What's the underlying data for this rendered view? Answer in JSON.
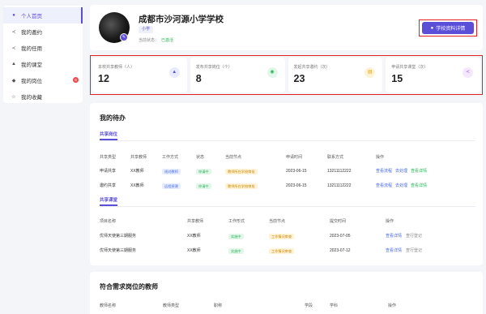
{
  "sidebar": {
    "items": [
      {
        "label": "个人首页",
        "icon": "user-icon",
        "glyph": "●",
        "active": true
      },
      {
        "label": "我的邀约",
        "icon": "share-icon",
        "glyph": "≺"
      },
      {
        "label": "我的任用",
        "icon": "share-icon",
        "glyph": "≺"
      },
      {
        "label": "我的课堂",
        "icon": "graduation-cap-icon",
        "glyph": "▲"
      },
      {
        "label": "我的岗位",
        "icon": "bell-icon",
        "glyph": "◆",
        "badge": "8"
      },
      {
        "label": "我的收藏",
        "icon": "star-icon",
        "glyph": "☆"
      }
    ]
  },
  "profile": {
    "name": "成都市沙河源小学学校",
    "type_tag": "小学",
    "status_label": "当前状态：",
    "status_value": "已激活",
    "detail_button": "学校资料详情"
  },
  "stats": [
    {
      "label": "本校共享教师（人）",
      "value": "12",
      "icon": "graduation-cap-icon",
      "glyph": "▲",
      "icon_bg": "#e8ebff",
      "icon_fg": "#5b4fd8"
    },
    {
      "label": "发布共享岗位（个）",
      "value": "8",
      "icon": "eye-icon",
      "glyph": "◉",
      "icon_bg": "#e3f6ea",
      "icon_fg": "#2bb45a"
    },
    {
      "label": "发起共享邀约（次）",
      "value": "23",
      "icon": "document-icon",
      "glyph": "▤",
      "icon_bg": "#fff3d6",
      "icon_fg": "#e0a020"
    },
    {
      "label": "申请共享课堂（次）",
      "value": "15",
      "icon": "share-icon",
      "glyph": "≺",
      "icon_bg": "#f3e8ff",
      "icon_fg": "#9b59d0"
    }
  ],
  "todo": {
    "title": "我的待办",
    "tab1": "共享岗位",
    "table1": {
      "headers": [
        "共享类型",
        "共享教师",
        "工作方式",
        "状态",
        "当前节点",
        "申请时间",
        "联系方式",
        "操作"
      ],
      "rows": [
        {
          "type": "申请共享",
          "teacher": "XX教师",
          "mode": "线对教师",
          "status": "申请中",
          "node": "教师所在学校审批",
          "time": "2023-06-15",
          "phone": "13211112222",
          "a1": "查看流程",
          "a2": "去处理",
          "a3": "查看详情"
        },
        {
          "type": "邀约共享",
          "teacher": "XX教师",
          "mode": "远程授课",
          "status": "申请中",
          "node": "教师所在学校审批",
          "time": "2023-06-15",
          "phone": "13211112222",
          "a1": "查看流程",
          "a2": "去处理",
          "a3": "查看详情"
        }
      ]
    },
    "tab2": "共享课堂",
    "table2": {
      "headers": [
        "项目名称",
        "共享教师",
        "工作形式",
        "当前节点",
        "提交时间",
        "操作"
      ],
      "rows": [
        {
          "name": "优师天使第三期服务",
          "teacher": "XX教师",
          "form": "实施中",
          "node": "工作情况审查",
          "time": "2023-07-05",
          "a1": "查看详情",
          "a2": "查行登记"
        },
        {
          "name": "优师天使第三期服务",
          "teacher": "XX教师",
          "form": "实施中",
          "node": "工作情况审查",
          "time": "2023-07-12",
          "a1": "查看详情",
          "a2": "查行登记"
        }
      ]
    }
  },
  "teachers": {
    "title": "符合需求岗位的教师",
    "headers": [
      "教师名称",
      "教师类型",
      "职称",
      "学段",
      "学科",
      "操作"
    ]
  }
}
